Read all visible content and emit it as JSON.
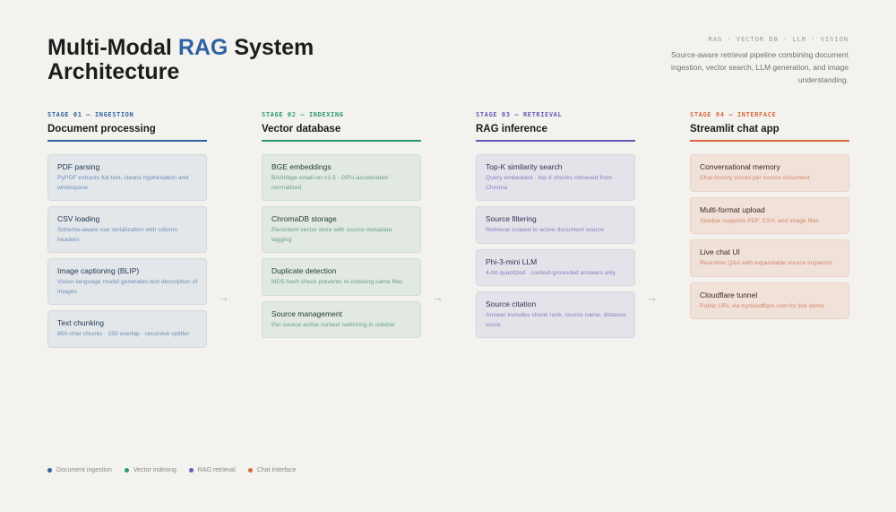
{
  "header": {
    "title_part1": "Multi-Modal ",
    "title_accent": "RAG",
    "title_part2": " System Architecture",
    "tagline": "RAG · VECTOR DB · LLM · VISION",
    "description": "Source-aware retrieval pipeline combining document ingestion, vector search, LLM generation, and image understanding."
  },
  "colors": {
    "ingestion": "#2f62a3",
    "indexing": "#2c9a6a",
    "retrieval": "#6a58b8",
    "interface": "#d9683e"
  },
  "stages": [
    {
      "label": "STAGE 01 — INGESTION",
      "title": "Document processing",
      "cards": [
        {
          "title": "PDF parsing",
          "desc": "PyPDF extracts full text, cleans hyphenation and whitespace"
        },
        {
          "title": "CSV loading",
          "desc": "Schema-aware row serialization with column headers"
        },
        {
          "title": "Image captioning (BLIP)",
          "desc": "Vision-language model generates text description of images"
        },
        {
          "title": "Text chunking",
          "desc": "800-char chunks · 150 overlap · recursive splitter"
        }
      ]
    },
    {
      "label": "STAGE 02 — INDEXING",
      "title": "Vector database",
      "cards": [
        {
          "title": "BGE embeddings",
          "desc": "BAAI/bge-small-en-v1.5 · GPU-accelerated · normalized"
        },
        {
          "title": "ChromaDB storage",
          "desc": "Persistent vector store with source metadata tagging"
        },
        {
          "title": "Duplicate detection",
          "desc": "MD5 hash check prevents re-indexing same files"
        },
        {
          "title": "Source management",
          "desc": "Per-source active context switching in sidebar"
        }
      ]
    },
    {
      "label": "STAGE 03 — RETRIEVAL",
      "title": "RAG inference",
      "cards": [
        {
          "title": "Top-K similarity search",
          "desc": "Query embedded · top 4 chunks retrieved from Chroma"
        },
        {
          "title": "Source filtering",
          "desc": "Retrieval scoped to active document source"
        },
        {
          "title": "Phi-3-mini LLM",
          "desc": "4-bit quantized · context-grounded answers only"
        },
        {
          "title": "Source citation",
          "desc": "Answer includes chunk rank, source name, distance score"
        }
      ]
    },
    {
      "label": "STAGE 04 — INTERFACE",
      "title": "Streamlit chat app",
      "cards": [
        {
          "title": "Conversational memory",
          "desc": "Chat history stored per source document"
        },
        {
          "title": "Multi-format upload",
          "desc": "Sidebar supports PDF, CSV, and image files"
        },
        {
          "title": "Live chat UI",
          "desc": "Real-time Q&A with expandable source inspector"
        },
        {
          "title": "Cloudflare tunnel",
          "desc": "Public URL via trycloudflare.com for live demo"
        }
      ]
    }
  ],
  "arrow_glyph": "→",
  "legend": [
    {
      "label": "Document ingestion",
      "color": "#2f62a3"
    },
    {
      "label": "Vector indexing",
      "color": "#2c9a6a"
    },
    {
      "label": "RAG retrieval",
      "color": "#6a58b8"
    },
    {
      "label": "Chat interface",
      "color": "#d9683e"
    }
  ]
}
